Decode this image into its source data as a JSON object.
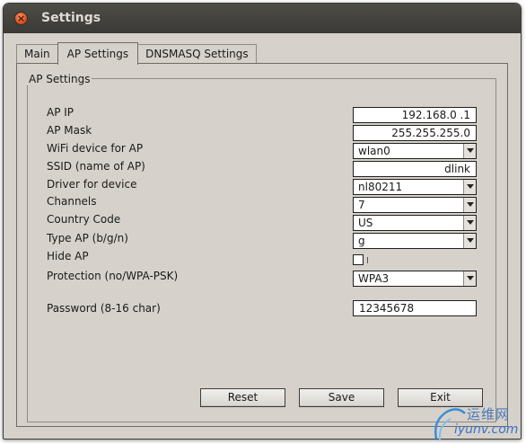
{
  "window": {
    "title": "Settings"
  },
  "tabs": [
    {
      "label": "Main"
    },
    {
      "label": "AP Settings"
    },
    {
      "label": "DNSMASQ Settings"
    }
  ],
  "active_tab": "AP Settings",
  "group": {
    "title": "AP Settings"
  },
  "fields": {
    "ap_ip": {
      "label": "AP IP",
      "value": "192.168.0  .1"
    },
    "ap_mask": {
      "label": "AP Mask",
      "value": "255.255.255.0"
    },
    "wifi_device": {
      "label": "WiFi device for AP",
      "value": "wlan0"
    },
    "ssid": {
      "label": "SSID (name of AP)",
      "value": "dlink"
    },
    "driver": {
      "label": "Driver for device",
      "value": "nl80211"
    },
    "channels": {
      "label": "Channels",
      "value": "7"
    },
    "country_code": {
      "label": "Country Code",
      "value": "US"
    },
    "type_ap": {
      "label": "Type AP (b/g/n)",
      "value": "g"
    },
    "hide_ap": {
      "label": "Hide AP",
      "checked": false
    },
    "protection": {
      "label": "Protection (no/WPA-PSK)",
      "value": "WPA3"
    },
    "password": {
      "label": "Password (8-16 char)",
      "value": "12345678"
    }
  },
  "buttons": {
    "reset": "Reset",
    "save": "Save",
    "exit": "Exit"
  },
  "watermark": {
    "text": "运维网",
    "url": "iyunv.com"
  },
  "icons": {
    "close": "close-icon",
    "dropdown": "chevron-down-icon"
  },
  "colors": {
    "titlebar": "#3b3a36",
    "close_button": "#e0501f",
    "window_bg": "#d6d2cb"
  }
}
